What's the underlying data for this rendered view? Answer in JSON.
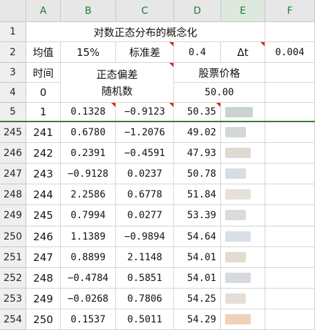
{
  "columns": [
    "A",
    "B",
    "C",
    "D",
    "E",
    "F"
  ],
  "rows_top": [
    "1",
    "2",
    "3",
    "4"
  ],
  "sheet": {
    "title": "对数正态分布的概念化"
  },
  "params": {
    "mean_label": "均值",
    "mean_value": "15%",
    "std_label": "标准差",
    "std_value": "0.4",
    "dt_label": "Δt",
    "dt_value": "0.004"
  },
  "headers": {
    "time": "时间",
    "time_start": "0",
    "deviation_line1": "正态偏差",
    "deviation_line2": "随机数",
    "stock_price": "股票价格",
    "start_price": "50.00"
  },
  "row5": {
    "row": "5",
    "t": "1",
    "b": "0.1328",
    "c": "−0.9123",
    "d": "50.35"
  },
  "data_rows": [
    {
      "row": "245",
      "t": "241",
      "b": "0.6780",
      "c": "−1.2076",
      "d": "49.02"
    },
    {
      "row": "246",
      "t": "242",
      "b": "0.2391",
      "c": "−0.4591",
      "d": "47.93"
    },
    {
      "row": "247",
      "t": "243",
      "b": "−0.9128",
      "c": "0.0237",
      "d": "50.78"
    },
    {
      "row": "248",
      "t": "244",
      "b": "2.2586",
      "c": "0.6778",
      "d": "51.84"
    },
    {
      "row": "249",
      "t": "245",
      "b": "0.7994",
      "c": "0.0277",
      "d": "53.39"
    },
    {
      "row": "250",
      "t": "246",
      "b": "1.1389",
      "c": "−0.9894",
      "d": "54.64"
    },
    {
      "row": "251",
      "t": "247",
      "b": "0.8899",
      "c": "2.1148",
      "d": "54.01"
    },
    {
      "row": "252",
      "t": "248",
      "b": "−0.4784",
      "c": "0.5851",
      "d": "54.01"
    },
    {
      "row": "253",
      "t": "249",
      "b": "−0.0268",
      "c": "0.7806",
      "d": "54.25"
    },
    {
      "row": "254",
      "t": "250",
      "b": "0.1537",
      "c": "0.5011",
      "d": "54.29"
    }
  ]
}
